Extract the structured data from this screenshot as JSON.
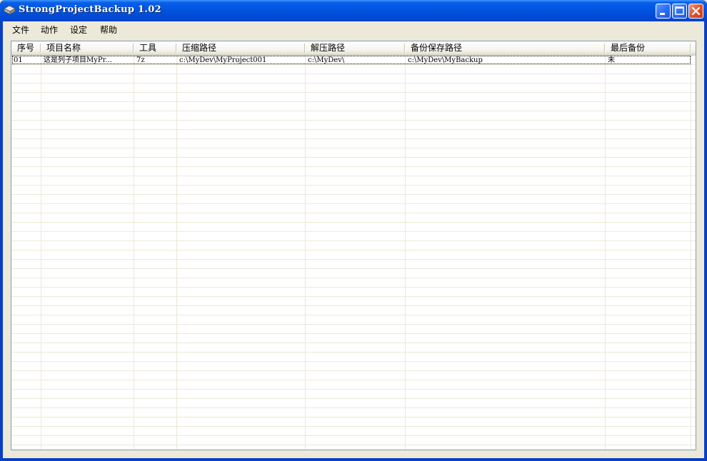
{
  "window": {
    "title": "StrongProjectBackup 1.02"
  },
  "menu": [
    "文件",
    "动作",
    "设定",
    "帮助"
  ],
  "table": {
    "columns": [
      "序号",
      "项目名称",
      "工具",
      "压缩路径",
      "解压路径",
      "备份保存路径",
      "最后备份"
    ],
    "rows": [
      [
        "01",
        "这是列子项目MyPr...",
        "7z",
        "c:\\MyDev\\MyProject001",
        "c:\\MyDev\\",
        "c:\\MyDev\\MyBackup",
        "未"
      ]
    ]
  },
  "colors": {
    "titlebar": "#0052e0",
    "frame": "#ece9d8",
    "list_border": "#7f9db9",
    "grid_line": "#ece9d8"
  }
}
